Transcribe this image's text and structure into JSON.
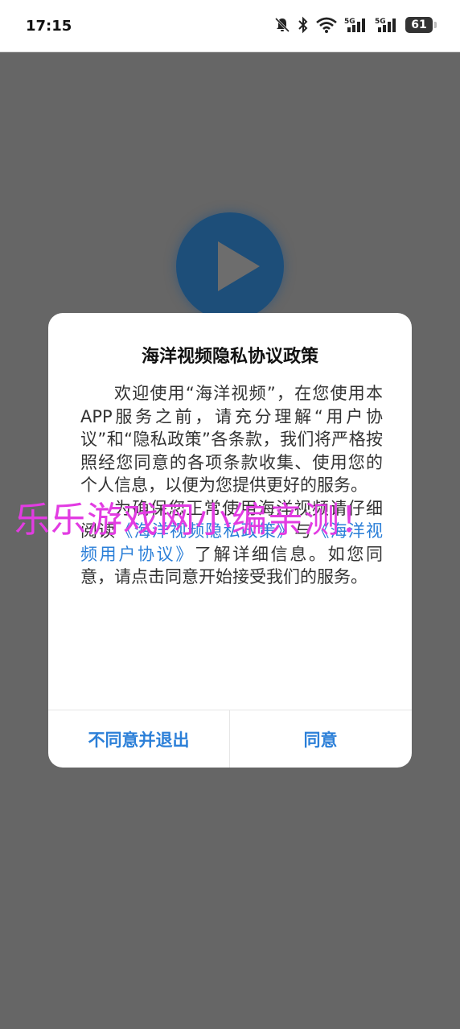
{
  "status_bar": {
    "time": "17:15",
    "battery": "61",
    "signal_1_label": "5G",
    "signal_2_label": "5G",
    "icons": [
      "bell-muted-icon",
      "bluetooth-icon",
      "wifi-icon",
      "signal-5g-icon",
      "signal-5g-icon",
      "battery-icon"
    ]
  },
  "background": {
    "play_icon": "play-icon"
  },
  "dialog": {
    "title": "海洋视频隐私协议政策",
    "para1": "欢迎使用“海洋视频”，在您使用本APP服务之前，请充分理解“用户协议”和“隐私政策”各条款，我们将严格按照经您同意的各项条款收集、使用您的个人信息，以便为您提供更好的服务。",
    "para2_before": "为确保您正常使用海洋视频请仔细阅读",
    "privacy_link": "《海洋视频隐私政策》",
    "para2_middle": "与",
    "user_link": "《海洋视频用户协议》",
    "para2_after": "了解详细信息。如您同意，请点击同意开始接受我们的服务。",
    "disagree_button": "不同意并退出",
    "agree_button": "同意"
  },
  "watermark": "乐乐游戏网小编亲测！",
  "colors": {
    "accent": "#2b7fd8",
    "overlay": "#666666",
    "watermark": "#e23ce2",
    "play_circle": "#1d4e79"
  }
}
